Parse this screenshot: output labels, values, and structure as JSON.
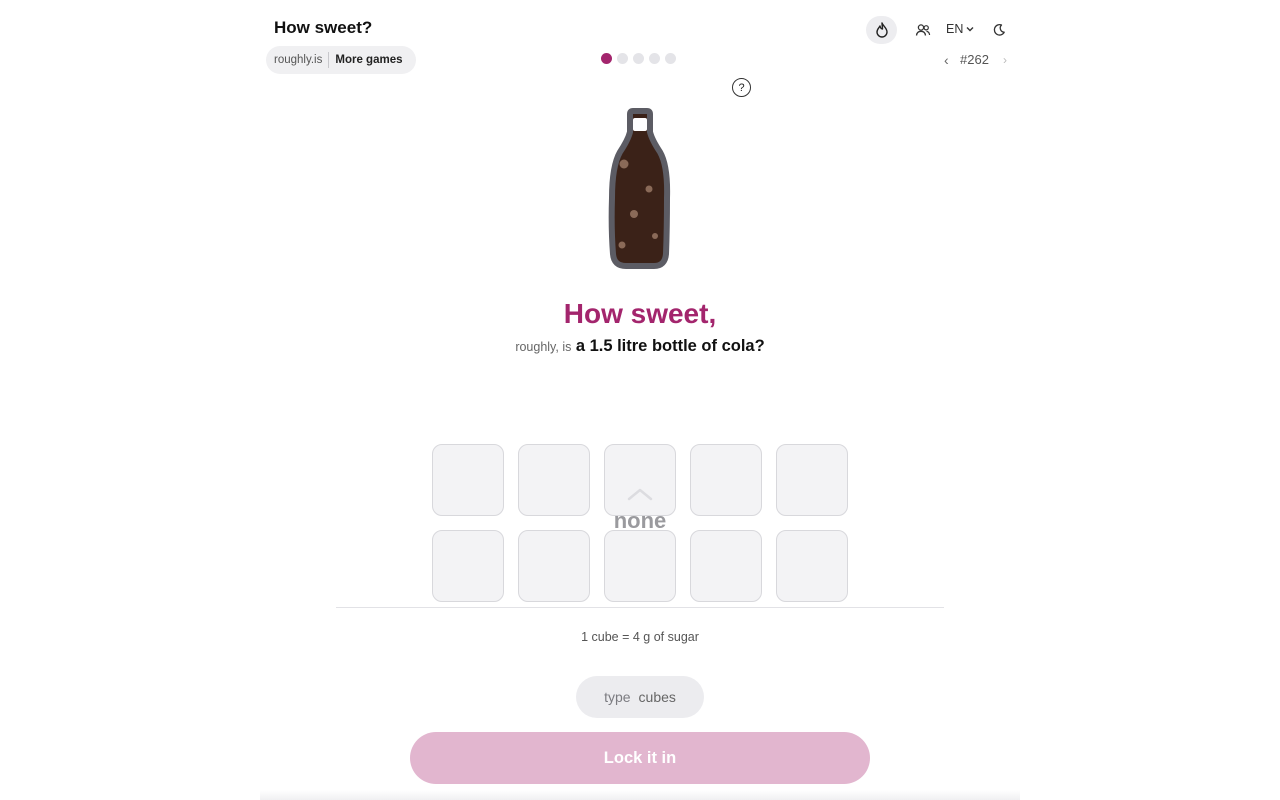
{
  "header": {
    "title": "How sweet?",
    "site_label": "roughly.is",
    "more_games_label": "More games",
    "language": "EN",
    "puzzle_number": "#262",
    "prev_symbol": "‹",
    "next_symbol": "›"
  },
  "icons": {
    "streak": "flame-icon",
    "friends": "users-icon",
    "language_dropdown": "chevron-down-icon",
    "theme": "moon-icon",
    "help": "help-icon"
  },
  "progress": {
    "total": 5,
    "current": 1
  },
  "help_label": "?",
  "question": {
    "headline": "How sweet,",
    "prefix": "roughly, is",
    "subject": "a 1.5 litre bottle of cola?"
  },
  "answer": {
    "current_value": "none",
    "cube_slots": 10,
    "cubes_filled": 0
  },
  "unit_note": "1 cube = 4 g of sugar",
  "input": {
    "placeholder": "type",
    "unit": "cubes"
  },
  "submit_label": "Lock it in",
  "colors": {
    "accent": "#a3256d",
    "accent_disabled": "#e2b6cf",
    "cola": "#3b2218",
    "bottle_outline": "#5c5c64"
  }
}
